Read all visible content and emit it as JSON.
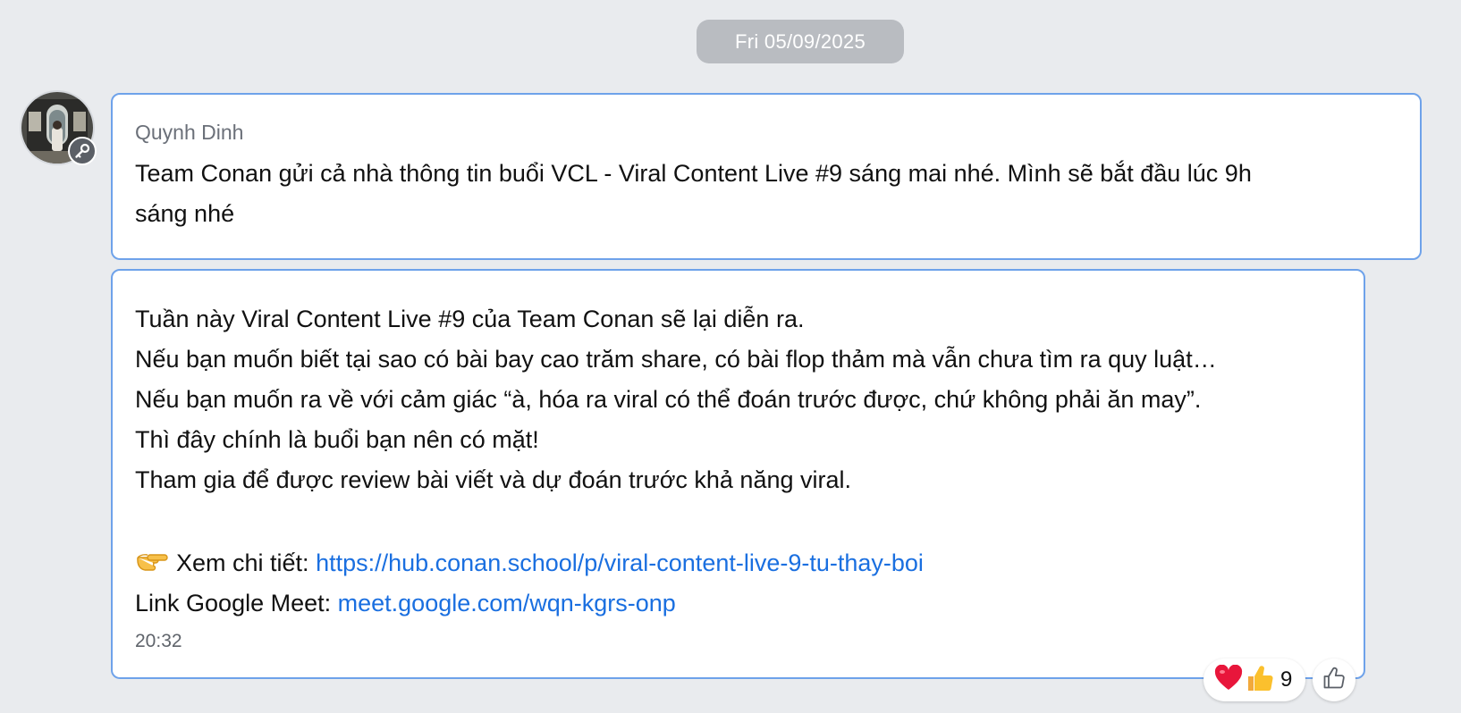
{
  "date_separator": "Fri 05/09/2025",
  "message_1": {
    "sender": "Quynh Dinh",
    "lines": [
      "Team Conan gửi cả nhà thông tin buổi VCL - Viral Content Live #9 sáng mai nhé. Mình sẽ bắt đầu lúc 9h",
      "sáng nhé"
    ]
  },
  "message_2": {
    "lines": [
      "Tuần này Viral Content Live #9 của Team Conan sẽ lại diễn ra.",
      "Nếu bạn muốn biết tại sao có bài bay cao trăm share, có bài flop thảm mà vẫn chưa tìm ra quy luật…",
      "Nếu bạn muốn ra về với cảm giác “à, hóa ra viral có thể đoán trước được, chứ không phải ăn may”.",
      "Thì đây chính là buổi bạn nên có mặt!",
      "Tham gia để được review bài viết và dự đoán trước khả năng viral."
    ],
    "detail_label": "Xem chi tiết: ",
    "detail_link": "https://hub.conan.school/p/viral-content-live-9-tu-thay-boi",
    "meet_label": "Link Google Meet: ",
    "meet_link": "meet.google.com/wqn-kgrs-onp",
    "time": "20:32"
  },
  "reactions": {
    "icons": [
      "heart-emoji",
      "thumbs-up-emoji"
    ],
    "count": "9"
  },
  "colors": {
    "background": "#e9ebee",
    "bubble_border": "#6ea2ea",
    "link": "#1a6fe0",
    "date_pill": "#b9bcc1"
  }
}
